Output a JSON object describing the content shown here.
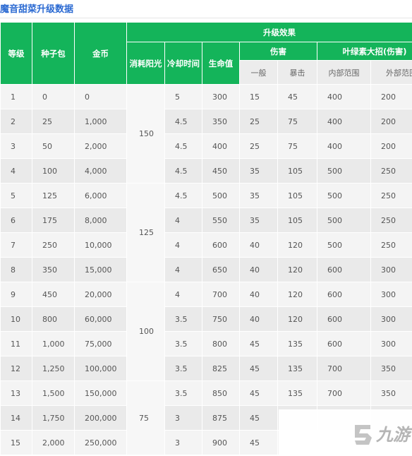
{
  "title": "魔音甜菜升级数据",
  "headers": {
    "level": "等级",
    "seeds": "种子包",
    "gold": "金币",
    "upgrade_effect": "升级效果",
    "sun_cost": "消耗阳光",
    "cooldown": "冷却时间",
    "hp": "生命值",
    "damage": "伤害",
    "ultimate": "叶绿素大招(伤害)",
    "damage_normal": "一般",
    "damage_crit": "暴击",
    "ult_inner": "内部范围",
    "ult_outer": "外部范围"
  },
  "sun_cost_groups": [
    "150",
    "125",
    "100",
    "75"
  ],
  "rows": [
    {
      "level": "1",
      "seeds": "0",
      "gold": "0",
      "cooldown": "5",
      "hp": "300",
      "normal": "15",
      "crit": "45",
      "inner": "400",
      "outer": "200"
    },
    {
      "level": "2",
      "seeds": "25",
      "gold": "1,000",
      "cooldown": "4.5",
      "hp": "350",
      "normal": "25",
      "crit": "75",
      "inner": "400",
      "outer": "200"
    },
    {
      "level": "3",
      "seeds": "50",
      "gold": "2,000",
      "cooldown": "4.5",
      "hp": "400",
      "normal": "25",
      "crit": "75",
      "inner": "400",
      "outer": "200"
    },
    {
      "level": "4",
      "seeds": "100",
      "gold": "4,000",
      "cooldown": "4.5",
      "hp": "450",
      "normal": "35",
      "crit": "105",
      "inner": "500",
      "outer": "250"
    },
    {
      "level": "5",
      "seeds": "125",
      "gold": "6,000",
      "cooldown": "4.5",
      "hp": "500",
      "normal": "35",
      "crit": "105",
      "inner": "500",
      "outer": "250"
    },
    {
      "level": "6",
      "seeds": "175",
      "gold": "8,000",
      "cooldown": "4",
      "hp": "550",
      "normal": "35",
      "crit": "105",
      "inner": "500",
      "outer": "250"
    },
    {
      "level": "7",
      "seeds": "250",
      "gold": "10,000",
      "cooldown": "4",
      "hp": "600",
      "normal": "40",
      "crit": "120",
      "inner": "500",
      "outer": "250"
    },
    {
      "level": "8",
      "seeds": "350",
      "gold": "15,000",
      "cooldown": "4",
      "hp": "650",
      "normal": "40",
      "crit": "120",
      "inner": "600",
      "outer": "300"
    },
    {
      "level": "9",
      "seeds": "450",
      "gold": "20,000",
      "cooldown": "4",
      "hp": "700",
      "normal": "40",
      "crit": "120",
      "inner": "600",
      "outer": "300"
    },
    {
      "level": "10",
      "seeds": "800",
      "gold": "60,000",
      "cooldown": "3.5",
      "hp": "750",
      "normal": "40",
      "crit": "120",
      "inner": "600",
      "outer": "300"
    },
    {
      "level": "11",
      "seeds": "1,000",
      "gold": "75,000",
      "cooldown": "3.5",
      "hp": "800",
      "normal": "45",
      "crit": "135",
      "inner": "600",
      "outer": "300"
    },
    {
      "level": "12",
      "seeds": "1,250",
      "gold": "100,000",
      "cooldown": "3.5",
      "hp": "825",
      "normal": "45",
      "crit": "135",
      "inner": "700",
      "outer": "350"
    },
    {
      "level": "13",
      "seeds": "1,500",
      "gold": "150,000",
      "cooldown": "3.5",
      "hp": "850",
      "normal": "45",
      "crit": "135",
      "inner": "700",
      "outer": "350"
    },
    {
      "level": "14",
      "seeds": "1,750",
      "gold": "200,000",
      "cooldown": "3",
      "hp": "875",
      "normal": "45",
      "crit": "",
      "inner": "",
      "outer": ""
    },
    {
      "level": "15",
      "seeds": "2,000",
      "gold": "250,000",
      "cooldown": "3",
      "hp": "900",
      "normal": "45",
      "crit": "",
      "inner": "",
      "outer": ""
    }
  ],
  "watermark": {
    "text": "九游",
    "icon": "jiuyou-logo-icon"
  }
}
